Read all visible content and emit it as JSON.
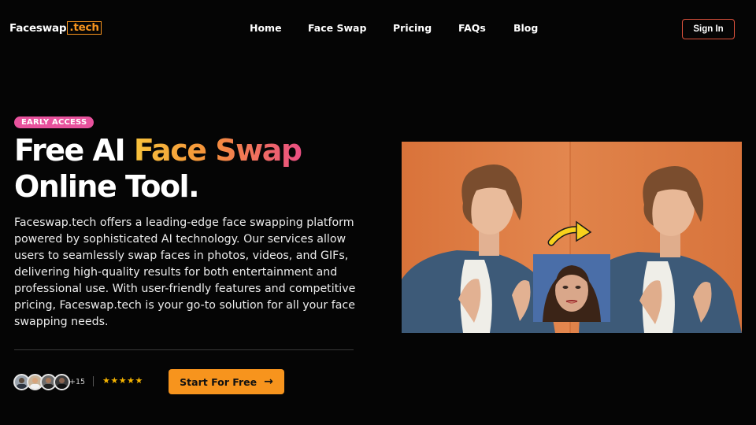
{
  "header": {
    "logo_main": "Faceswap",
    "logo_accent": ".tech",
    "nav": [
      {
        "label": "Home"
      },
      {
        "label": "Face Swap"
      },
      {
        "label": "Pricing"
      },
      {
        "label": "FAQs"
      },
      {
        "label": "Blog"
      }
    ],
    "signin_label": "Sign In"
  },
  "hero": {
    "badge": "EARLY ACCESS",
    "title_part1": "Free AI ",
    "title_highlight": "Face Swap",
    "title_line2": "Online Tool.",
    "description": "Faceswap.tech offers a leading-edge face swapping platform powered by sophisticated AI technology. Our services allow users to seamlessly swap faces in photos, videos, and GIFs, delivering high-quality results for both entertainment and professional use. With user-friendly features and competitive pricing, Faceswap.tech is your go-to solution for all your face swapping needs.",
    "user_count": "+15",
    "rating_stars": "★★★★★",
    "rating": 5,
    "cta_label": "Start For Free",
    "cta_icon": "arrow-right-icon"
  },
  "colors": {
    "background": "#050505",
    "accent_orange": "#f7941d",
    "badge_pink": "#e8529d",
    "signin_border": "#e0533d",
    "star": "#f7b500"
  }
}
